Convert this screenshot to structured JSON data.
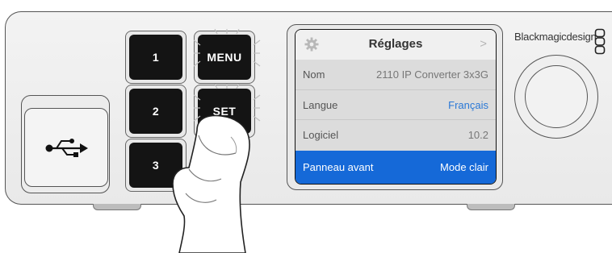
{
  "buttons": {
    "btn1": "1",
    "btn2": "2",
    "btn3": "3",
    "menu": "MENU",
    "set": "SET"
  },
  "lcd": {
    "title": "Réglages",
    "chevron": ">",
    "rows": [
      {
        "label": "Nom",
        "value": "2110 IP Converter 3x3G"
      },
      {
        "label": "Langue",
        "value": "Français"
      },
      {
        "label": "Logiciel",
        "value": "10.2"
      },
      {
        "label": "Panneau avant",
        "value": "Mode clair"
      }
    ]
  },
  "brand": {
    "name": "Blackmagicdesign"
  },
  "colors": {
    "selection": "#1569d8",
    "link_value": "#2a78d6",
    "button": "#141414"
  },
  "icons": [
    "usb-icon",
    "gear-icon",
    "chevron-right-icon",
    "blackmagic-logo-icon",
    "press-glow-icon",
    "pressing-finger-icon"
  ]
}
